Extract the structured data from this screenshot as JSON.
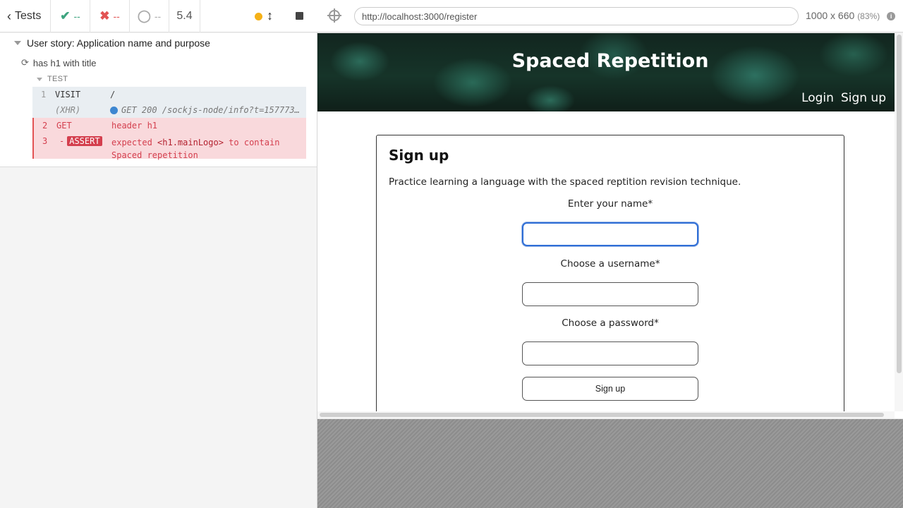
{
  "runner": {
    "back_label": "Tests",
    "passed": "--",
    "failed": "--",
    "pending": "--",
    "duration": "5.4"
  },
  "reporter": {
    "suite_title": "User story: Application name and purpose",
    "test_title": "has h1 with title",
    "hook_label": "TEST",
    "commands": [
      {
        "num": "1",
        "name": "VISIT",
        "message": "/"
      },
      {
        "num": "",
        "name": "(XHR)",
        "message": "GET 200 /sockjs-node/info?t=157773…"
      },
      {
        "num": "2",
        "name": "GET",
        "message": "header h1"
      },
      {
        "num": "3",
        "name": "- ",
        "badge": "ASSERT",
        "message_pre": "expected ",
        "message_el": "<h1.mainLogo>",
        "message_post": " to contain",
        "message_line2": "Spaced repetition"
      }
    ]
  },
  "aut": {
    "url": "http://localhost:3000/register",
    "viewport": "1000 x 660",
    "scale": "(83%)"
  },
  "app": {
    "title": "Spaced Repetition",
    "nav": {
      "login": "Login",
      "signup": "Sign up"
    },
    "form": {
      "heading": "Sign up",
      "description": "Practice learning a language with the spaced reptition revision technique.",
      "name_label": "Enter your name*",
      "username_label": "Choose a username*",
      "password_label": "Choose a password*",
      "submit_label": "Sign up"
    }
  },
  "colors": {
    "passed": "#3da47f",
    "failed": "#e25353",
    "assert_bg": "#f9d9dc",
    "focus_border": "#2f6ed6"
  }
}
